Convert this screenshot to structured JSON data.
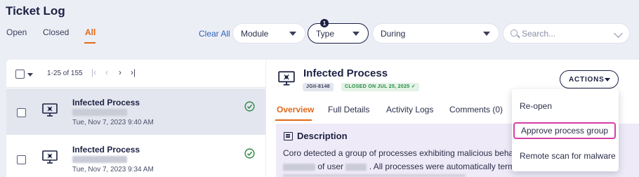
{
  "page": {
    "title": "Ticket Log"
  },
  "tabs": {
    "open": "Open",
    "closed": "Closed",
    "all": "All"
  },
  "filters": {
    "clear_all": "Clear All",
    "module": "Module",
    "type": "Type",
    "type_badge": "1",
    "during": "During",
    "search_placeholder": "Search..."
  },
  "list": {
    "range": "1-25 of 155",
    "pager": {
      "first": "|‹",
      "prev": "‹",
      "next": "›",
      "last": "›|"
    },
    "rows": [
      {
        "title": "Infected Process",
        "date": "Tue, Nov 7, 2023 9:40 AM",
        "status_icon": "check-circle-icon"
      },
      {
        "title": "Infected Process",
        "date": "Tue, Nov 7, 2023 9:34 AM",
        "status_icon": "check-circle-icon"
      }
    ]
  },
  "detail": {
    "title": "Infected Process",
    "ticket_id": "JGII-8148",
    "status": "CLOSED ON JUL 25, 2025 ✓",
    "actions_label": "ACTIONS",
    "tabs": [
      "Overview",
      "Full Details",
      "Activity Logs",
      "Comments (0)"
    ],
    "description_title": "Description",
    "description_line1": "Coro detected a group of processes exhibiting malicious behavior",
    "description_line2_a": "of user",
    "description_line2_b": ". All processes were automatically term"
  },
  "actions_menu": {
    "items": [
      "Re-open",
      "Approve process group",
      "Remote scan for malware"
    ]
  },
  "colors": {
    "accent": "#e0691a",
    "navy": "#1c2143",
    "link": "#2e63b8",
    "success": "#2b8a45",
    "highlight": "#d43fa6"
  }
}
